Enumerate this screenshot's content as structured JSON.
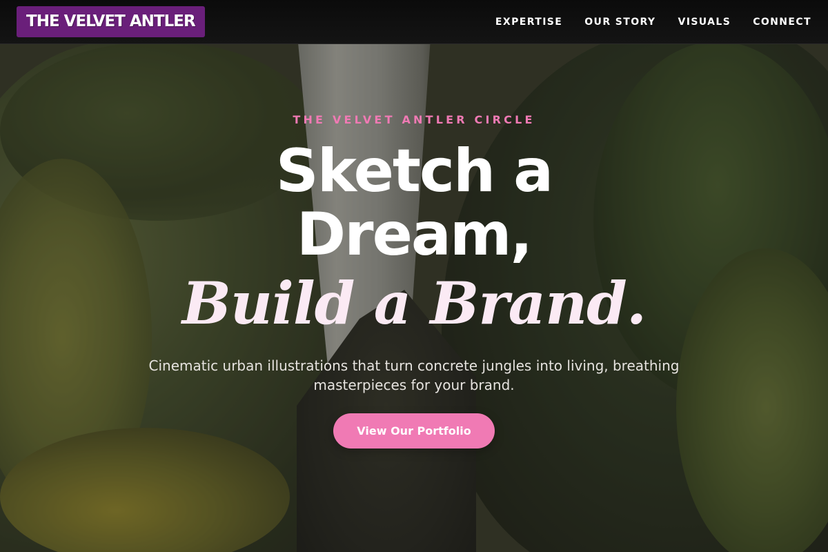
{
  "header": {
    "logo": "THE VELVET ANTLER",
    "nav": [
      {
        "label": "EXPERTISE"
      },
      {
        "label": "OUR STORY"
      },
      {
        "label": "VISUALS"
      },
      {
        "label": "CONNECT"
      }
    ]
  },
  "hero": {
    "eyebrow": "THE VELVET ANTLER CIRCLE",
    "headline_line1": "Sketch a",
    "headline_line2": "Dream,",
    "headline_accent": "Build a Brand.",
    "subtitle": "Cinematic urban illustrations that turn concrete jungles into living, breathing masterpieces for your brand.",
    "cta_label": "View Our Portfolio"
  },
  "colors": {
    "brand_purple": "#6a1f7a",
    "accent_pink": "#f07ab4",
    "header_bg": "#0b0b0b"
  }
}
